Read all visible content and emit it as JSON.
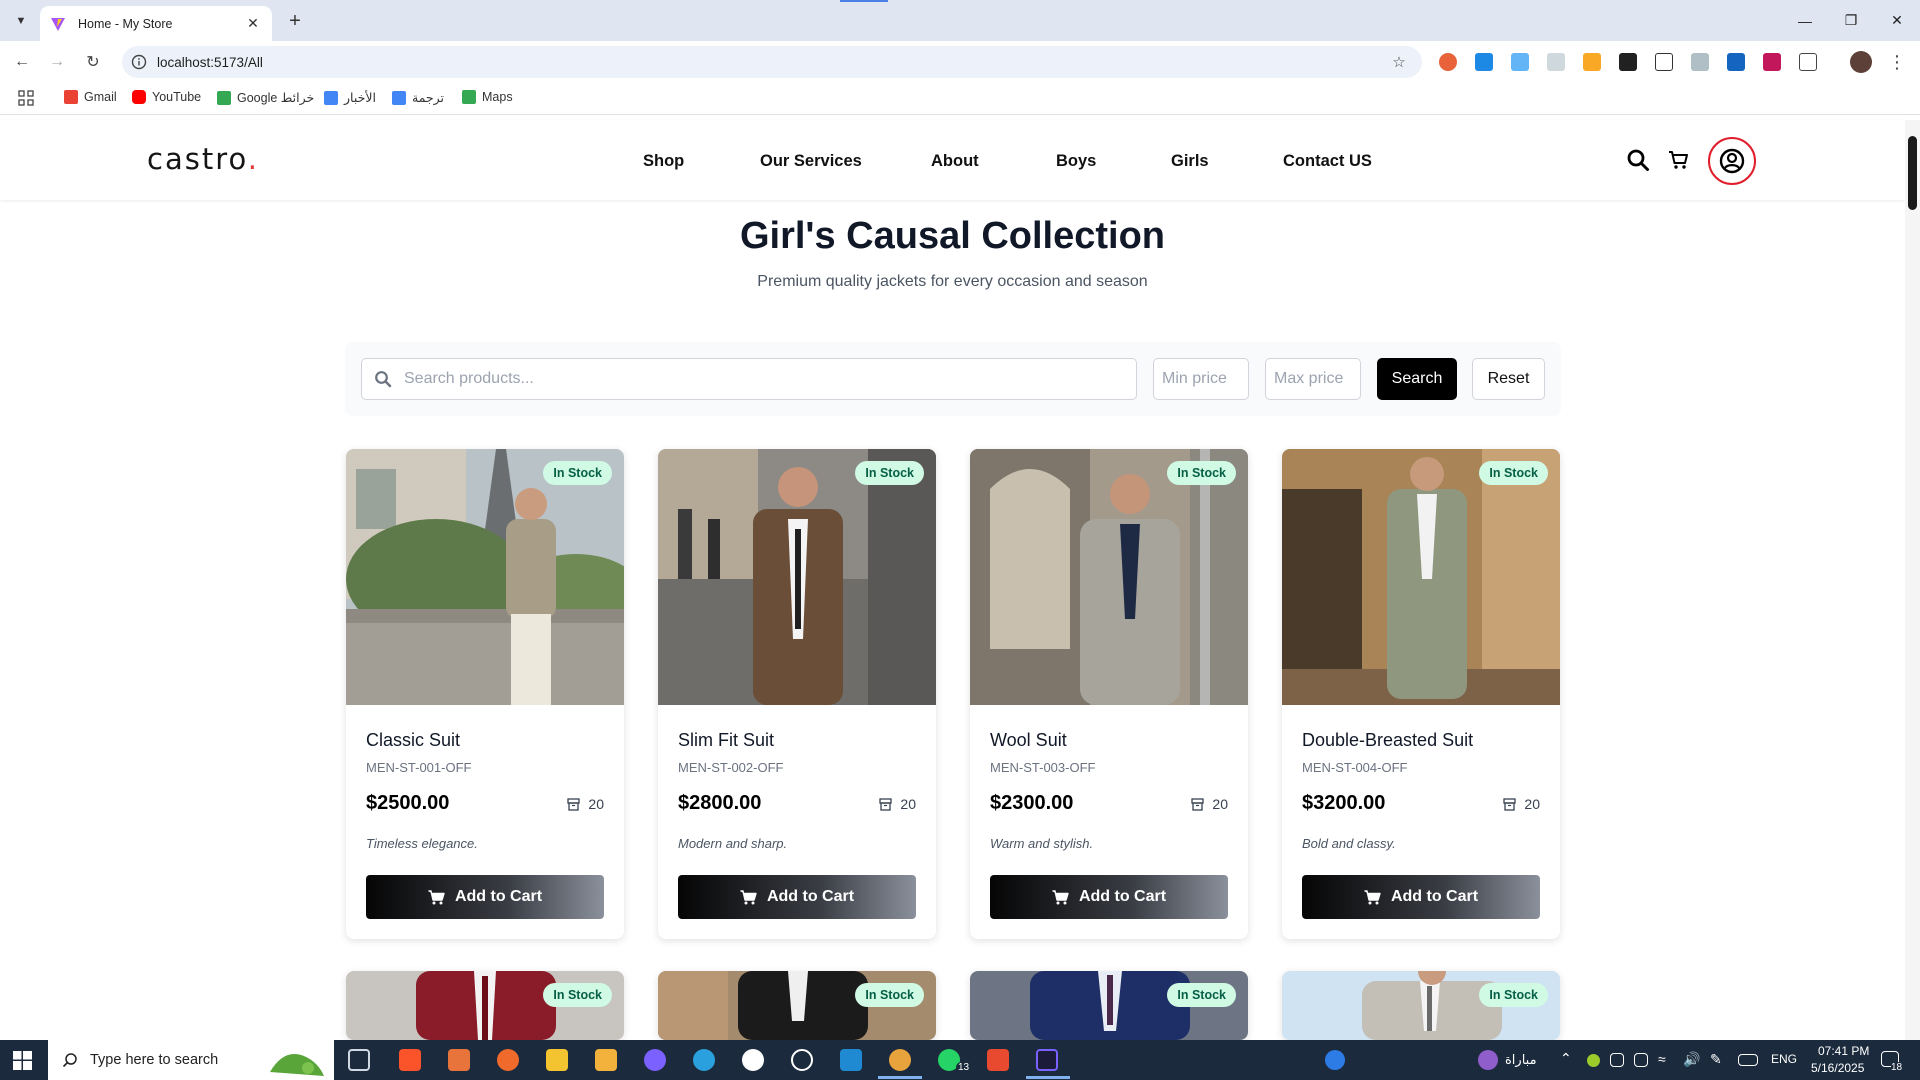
{
  "browser": {
    "tab_title": "Home - My Store",
    "url": "localhost:5173/All",
    "bookmarks": [
      {
        "label": "Gmail",
        "icon": "gmail-icon",
        "color": "#ea4335"
      },
      {
        "label": "YouTube",
        "icon": "youtube-icon",
        "color": "#ff0000"
      },
      {
        "label": "Google خرائط",
        "icon": "google-maps-icon",
        "color": "#34a853"
      },
      {
        "label": "الأخبار",
        "icon": "google-news-icon",
        "color": "#4285f4"
      },
      {
        "label": "ترجمة",
        "icon": "google-translate-icon",
        "color": "#4285f4"
      },
      {
        "label": "Maps",
        "icon": "maps-icon",
        "color": "#34a853"
      }
    ]
  },
  "header": {
    "logo": "castro",
    "logo_dot": ".",
    "nav": [
      "Shop",
      "Our Services",
      "About",
      "Boys",
      "Girls",
      "Contact US"
    ]
  },
  "hero": {
    "title": "Girl's Causal Collection",
    "subtitle": "Premium quality jackets for every occasion and season"
  },
  "filters": {
    "search_placeholder": "Search products...",
    "min_placeholder": "Min price",
    "max_placeholder": "Max price",
    "search_button": "Search",
    "reset_button": "Reset"
  },
  "products": [
    {
      "badge": "In Stock",
      "name": "Classic Suit",
      "sku": "MEN-ST-001-OFF",
      "price": "$2500.00",
      "stock": "20",
      "desc": "Timeless elegance.",
      "button": "Add to Cart"
    },
    {
      "badge": "In Stock",
      "name": "Slim Fit Suit",
      "sku": "MEN-ST-002-OFF",
      "price": "$2800.00",
      "stock": "20",
      "desc": "Modern and sharp.",
      "button": "Add to Cart"
    },
    {
      "badge": "In Stock",
      "name": "Wool Suit",
      "sku": "MEN-ST-003-OFF",
      "price": "$2300.00",
      "stock": "20",
      "desc": "Warm and stylish.",
      "button": "Add to Cart"
    },
    {
      "badge": "In Stock",
      "name": "Double-Breasted Suit",
      "sku": "MEN-ST-004-OFF",
      "price": "$3200.00",
      "stock": "20",
      "desc": "Bold and classy.",
      "button": "Add to Cart"
    }
  ],
  "products_row2": [
    {
      "badge": "In Stock"
    },
    {
      "badge": "In Stock"
    },
    {
      "badge": "In Stock"
    },
    {
      "badge": "In Stock"
    }
  ],
  "taskbar": {
    "search_placeholder": "Type here to search",
    "whatsapp_count": "13",
    "weather_label": "مباراة",
    "language": "ENG",
    "time": "07:41 PM",
    "date": "5/16/2025",
    "notification_count": "18"
  },
  "colors": {
    "accent_red": "#e11d2a",
    "in_stock_bg": "#d1fae5",
    "in_stock_text": "#065f46",
    "button_dark": "#000000"
  }
}
